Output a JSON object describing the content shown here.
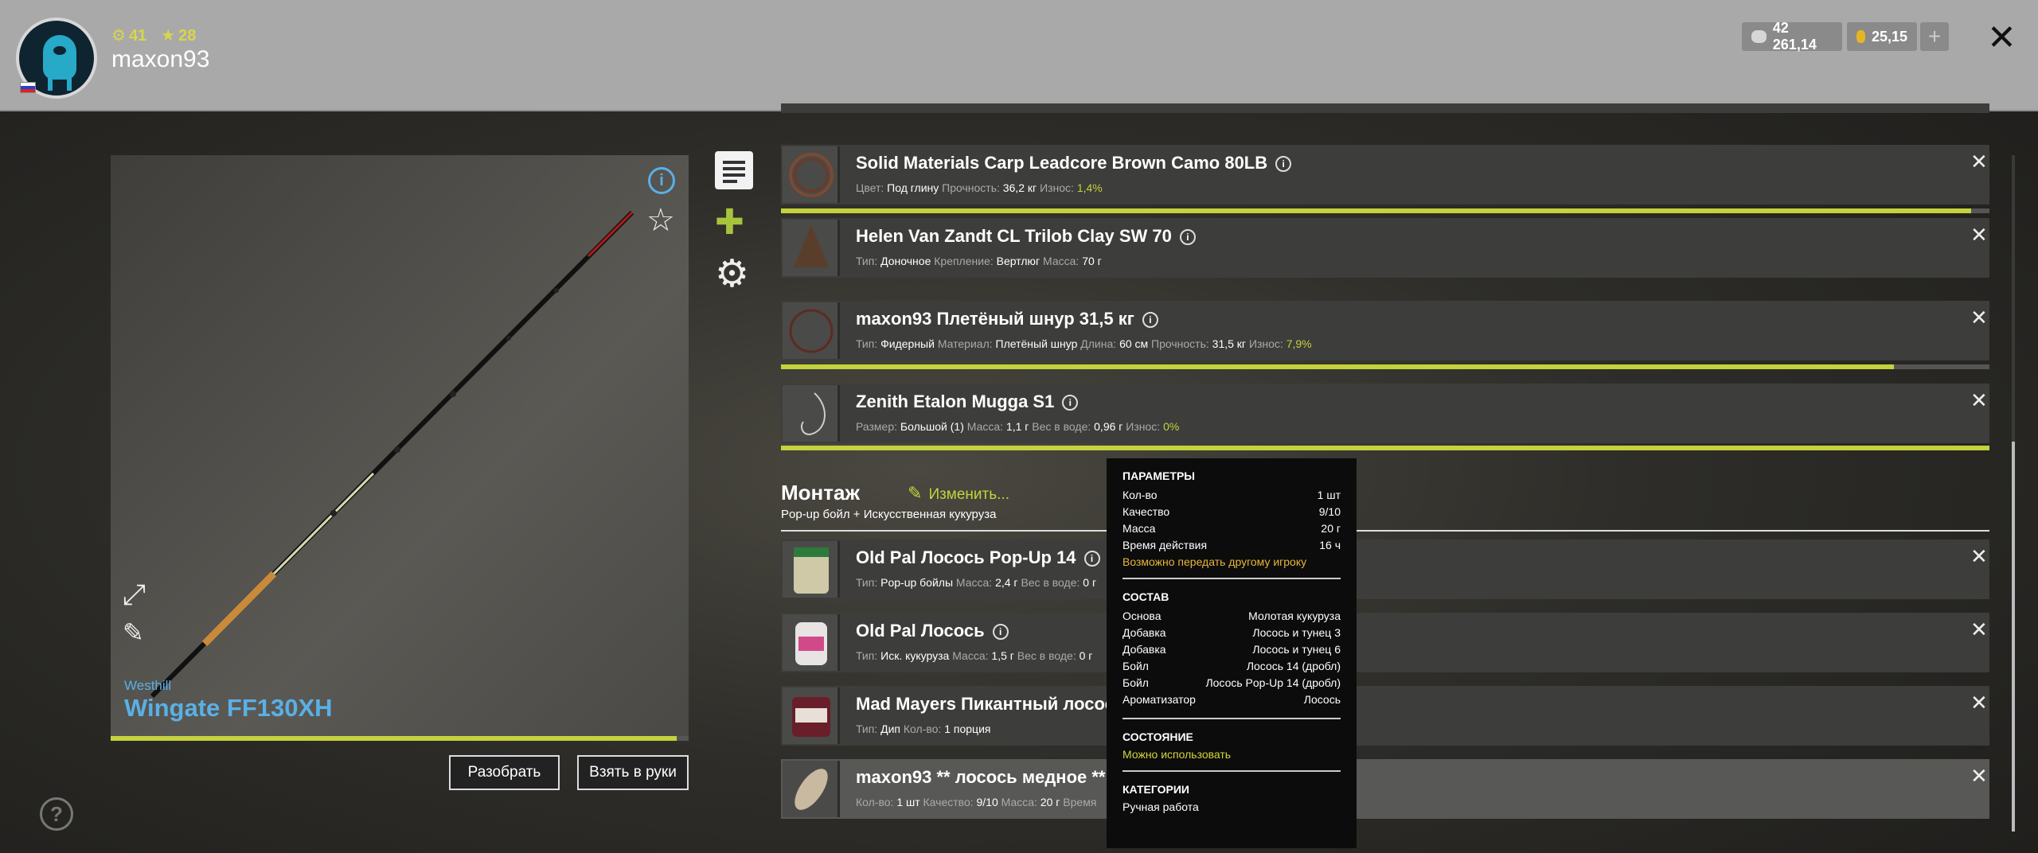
{
  "header": {
    "stat_level": "41",
    "stat_rank": "28",
    "username": "maxon93",
    "silver": "42 261,14",
    "gold": "25,15",
    "plus_label": "+",
    "close_label": "✕"
  },
  "rod": {
    "brand": "Westhill",
    "name": "Wingate FF130XH",
    "condition": 0.98,
    "disassemble_label": "Разобрать",
    "take_label": "Взять в руки"
  },
  "items": [
    {
      "name": "Solid Materials Carp Leadcore Brown Camo 80LB",
      "props": [
        {
          "k": "Цвет:",
          "v": "Под глину"
        },
        {
          "k": "Прочность:",
          "v": "36,2 кг"
        },
        {
          "k": "Износ:",
          "v": "1,4%",
          "g": true
        }
      ],
      "wear": 0.985
    },
    {
      "name": "Helen Van Zandt CL Trilob Clay SW 70",
      "props": [
        {
          "k": "Тип:",
          "v": "Доночное"
        },
        {
          "k": "Крепление:",
          "v": "Вертлюг"
        },
        {
          "k": "Масса:",
          "v": "70 г"
        }
      ]
    },
    {
      "name": "maxon93 Плетёный шнур 31,5 кг",
      "props": [
        {
          "k": "Тип:",
          "v": "Фидерный"
        },
        {
          "k": "Материал:",
          "v": "Плетёный шнур"
        },
        {
          "k": "Длина:",
          "v": "60 см"
        },
        {
          "k": "Прочность:",
          "v": "31,5 кг"
        },
        {
          "k": "Износ:",
          "v": "7,9%",
          "g": true
        }
      ],
      "wear": 0.921
    },
    {
      "name": "Zenith Etalon Mugga S1",
      "props": [
        {
          "k": "Размер:",
          "v": "Большой (1)"
        },
        {
          "k": "Масса:",
          "v": "1,1 г"
        },
        {
          "k": "Вес в воде:",
          "v": "0,96 г"
        },
        {
          "k": "Износ:",
          "v": "0%",
          "g": true
        }
      ],
      "wear": 1.0
    }
  ],
  "montage": {
    "title": "Монтаж",
    "change_label": "Изменить...",
    "subtitle": "Pop-up бойл  +  Искусственная кукуруза"
  },
  "bait_items": [
    {
      "name": "Old Pal Лосось Pop-Up 14",
      "props": [
        {
          "k": "Тип:",
          "v": "Pop-up бойлы"
        },
        {
          "k": "Масса:",
          "v": "2,4 г"
        },
        {
          "k": "Вес в воде:",
          "v": "0 г"
        }
      ]
    },
    {
      "name": "Old Pal Лосось",
      "props": [
        {
          "k": "Тип:",
          "v": "Иск. кукуруза"
        },
        {
          "k": "Масса:",
          "v": "1,5 г"
        },
        {
          "k": "Вес в воде:",
          "v": "0 г"
        }
      ]
    },
    {
      "name": "Mad Mayers Пикантный лосось",
      "props": [
        {
          "k": "Тип:",
          "v": "Дип"
        },
        {
          "k": "Кол-во:",
          "v": "1 порция"
        }
      ]
    },
    {
      "name": "maxon93 ** лосось медное **",
      "props": [
        {
          "k": "Кол-во:",
          "v": "1 шт"
        },
        {
          "k": "Качество:",
          "v": "9/10"
        },
        {
          "k": "Масса:",
          "v": "20 г"
        },
        {
          "k": "Время",
          "v": ""
        }
      ]
    }
  ],
  "tooltip": {
    "params_title": "ПАРАМЕТРЫ",
    "params": [
      {
        "k": "Кол-во",
        "v": "1 шт"
      },
      {
        "k": "Качество",
        "v": "9/10"
      },
      {
        "k": "Масса",
        "v": "20 г"
      },
      {
        "k": "Время действия",
        "v": "16 ч"
      }
    ],
    "transfer_note": "Возможно передать другому игроку",
    "composition_title": "СОСТАВ",
    "composition": [
      {
        "k": "Основа",
        "v": "Молотая кукуруза"
      },
      {
        "k": "Добавка",
        "v": "Лосось и тунец 3"
      },
      {
        "k": "Добавка",
        "v": "Лосось и тунец 6"
      },
      {
        "k": "Бойл",
        "v": "Лосось 14 (дробл)"
      },
      {
        "k": "Бойл",
        "v": "Лосось Pop-Up 14 (дробл)"
      },
      {
        "k": "Ароматизатор",
        "v": "Лосось"
      }
    ],
    "state_title": "СОСТОЯНИЕ",
    "state_value": "Можно использовать",
    "categories_title": "КАТЕГОРИИ",
    "categories_value": "Ручная работа"
  },
  "colors": {
    "accent": "#c4d23c",
    "rod_blue": "#5ab0e6",
    "tooltip_yellow": "#e8b637"
  }
}
